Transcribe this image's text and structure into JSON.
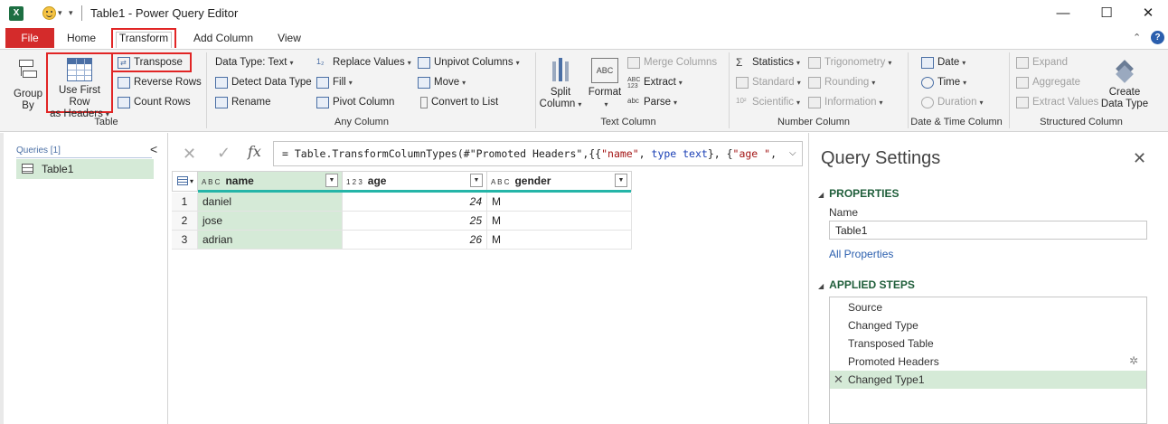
{
  "window": {
    "logo": "X",
    "title": "Table1 - Power Query Editor",
    "controls": {
      "minimize": "—",
      "maximize": "☐",
      "close": "✕"
    }
  },
  "ribbon_tabs": [
    {
      "label": "File"
    },
    {
      "label": "Home"
    },
    {
      "label": "Transform"
    },
    {
      "label": "Add Column"
    },
    {
      "label": "View"
    }
  ],
  "ribbon": {
    "help": "?",
    "collapse": "⌃",
    "table_group": {
      "label": "Table",
      "group_by": "Group\nBy",
      "group_by_1": "Group",
      "group_by_2": "By",
      "use_first_row_1": "Use First Row",
      "use_first_row_2": "as Headers",
      "transpose": "Transpose",
      "reverse_rows": "Reverse Rows",
      "count_rows": "Count Rows"
    },
    "any_column_group": {
      "label": "Any Column",
      "data_type": "Data Type: Text",
      "detect_data_type": "Detect Data Type",
      "rename": "Rename",
      "replace_values": "Replace Values",
      "fill": "Fill",
      "pivot_column": "Pivot Column",
      "unpivot_columns": "Unpivot Columns",
      "move": "Move",
      "convert_to_list": "Convert to List"
    },
    "text_column_group": {
      "label": "Text Column",
      "split_1": "Split",
      "split_2": "Column",
      "format": "Format",
      "merge_columns": "Merge Columns",
      "extract": "Extract",
      "parse": "Parse",
      "abc_icon": "ABC",
      "abc123_icon_1": "ABC",
      "abc123_icon_2": "123",
      "abc_small": "abc"
    },
    "number_column_group": {
      "label": "Number Column",
      "statistics": "Statistics",
      "standard": "Standard",
      "scientific": "Scientific",
      "trigonometry": "Trigonometry",
      "rounding": "Rounding",
      "information": "Information"
    },
    "date_time_group": {
      "label": "Date & Time Column",
      "date": "Date",
      "time": "Time",
      "duration": "Duration"
    },
    "structured_group": {
      "label": "Structured Column",
      "expand": "Expand",
      "aggregate": "Aggregate",
      "extract_values": "Extract Values",
      "create_1": "Create",
      "create_2": "Data Type"
    }
  },
  "queries": {
    "header": "Queries [1]",
    "collapse": "<",
    "items": [
      {
        "label": "Table1"
      }
    ]
  },
  "formula": {
    "cancel": "✕",
    "commit": "✓",
    "fx": "fx",
    "prefix": "= Table.TransformColumnTypes(#\"Promoted Headers\",{{",
    "s1": "\"name\"",
    "mid1": ", ",
    "kw1": "type text",
    "mid2": "}, {",
    "s2": "\"age \"",
    "tail": ",",
    "expand": "⌵"
  },
  "grid": {
    "columns": [
      {
        "type_icon": "A B C",
        "name": "name"
      },
      {
        "type_icon": "1 2 3",
        "name": "age"
      },
      {
        "type_icon": "A B C",
        "name": "gender"
      }
    ],
    "rows": [
      {
        "num": "1",
        "name": "daniel",
        "age": "24",
        "gender": "M"
      },
      {
        "num": "2",
        "name": "jose",
        "age": "25",
        "gender": "M"
      },
      {
        "num": "3",
        "name": "adrian",
        "age": "26",
        "gender": "M"
      }
    ]
  },
  "query_settings": {
    "title": "Query Settings",
    "close": "✕",
    "properties_label": "PROPERTIES",
    "name_label": "Name",
    "name_value": "Table1",
    "all_properties": "All Properties",
    "applied_steps_label": "APPLIED STEPS",
    "steps": [
      {
        "label": "Source"
      },
      {
        "label": "Changed Type"
      },
      {
        "label": "Transposed Table"
      },
      {
        "label": "Promoted Headers"
      },
      {
        "label": "Changed Type1"
      }
    ]
  },
  "colors": {
    "file_tab": "#d42b2b",
    "highlight": "#e12525",
    "selection": "#d5ead7",
    "column_quality": "#25b5a8",
    "section_header": "#1f5e3a",
    "link": "#2b5fae"
  }
}
